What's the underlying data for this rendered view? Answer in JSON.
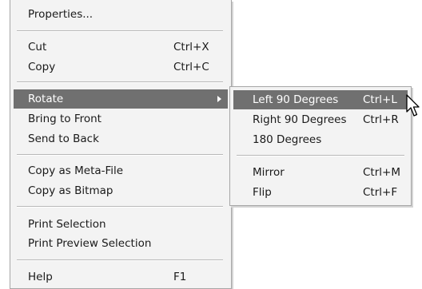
{
  "main_menu": {
    "items": [
      {
        "label": "Properties...",
        "shortcut": ""
      },
      {
        "label": "Cut",
        "shortcut": "Ctrl+X"
      },
      {
        "label": "Copy",
        "shortcut": "Ctrl+C"
      },
      {
        "label": "Rotate",
        "shortcut": ""
      },
      {
        "label": "Bring to Front",
        "shortcut": ""
      },
      {
        "label": "Send to Back",
        "shortcut": ""
      },
      {
        "label": "Copy as Meta-File",
        "shortcut": ""
      },
      {
        "label": "Copy as Bitmap",
        "shortcut": ""
      },
      {
        "label": "Print Selection",
        "shortcut": ""
      },
      {
        "label": "Print Preview Selection",
        "shortcut": ""
      },
      {
        "label": "Help",
        "shortcut": "F1"
      }
    ]
  },
  "sub_menu": {
    "items": [
      {
        "label": "Left 90 Degrees",
        "shortcut": "Ctrl+L"
      },
      {
        "label": "Right 90 Degrees",
        "shortcut": "Ctrl+R"
      },
      {
        "label": "180 Degrees",
        "shortcut": ""
      },
      {
        "label": "Mirror",
        "shortcut": "Ctrl+M"
      },
      {
        "label": "Flip",
        "shortcut": "Ctrl+F"
      }
    ]
  },
  "colors": {
    "menu_background": "#f3f3f3",
    "highlight": "#707070",
    "highlight_text": "#ffffff",
    "separator": "#b8b8b8"
  },
  "icons": {
    "submenu_arrow": "chevron-right-icon",
    "cursor": "mouse-pointer-icon"
  }
}
